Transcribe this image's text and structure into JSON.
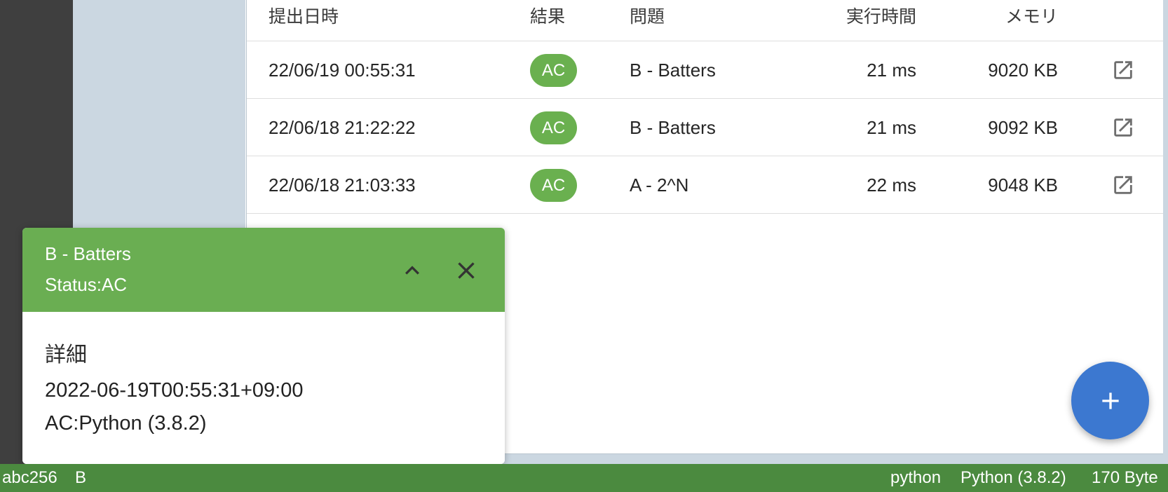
{
  "table": {
    "headers": {
      "date": "提出日時",
      "result": "結果",
      "problem": "問題",
      "time": "実行時間",
      "memory": "メモリ"
    },
    "rows": [
      {
        "date": "22/06/19 00:55:31",
        "result": "AC",
        "problem": "B - Batters",
        "time": "21 ms",
        "memory": "9020 KB"
      },
      {
        "date": "22/06/18 21:22:22",
        "result": "AC",
        "problem": "B - Batters",
        "time": "21 ms",
        "memory": "9092 KB"
      },
      {
        "date": "22/06/18 21:03:33",
        "result": "AC",
        "problem": "A - 2^N",
        "time": "22 ms",
        "memory": "9048 KB"
      }
    ]
  },
  "notification": {
    "title": "B - Batters",
    "status": "Status:AC",
    "detail_title": "詳細",
    "detail_time": "2022-06-19T00:55:31+09:00",
    "detail_lang": "AC:Python (3.8.2)"
  },
  "status_bar": {
    "contest": "abc256",
    "problem": "B",
    "language_id": "python",
    "language_name": "Python (3.8.2)",
    "size": "170 Byte"
  },
  "icons": {
    "open": "open-in-new-icon",
    "collapse": "chevron-up-icon",
    "close": "close-icon",
    "fab": "plus-icon"
  },
  "colors": {
    "accepted_badge": "#6ab04f",
    "notification_header": "#6aae52",
    "fab": "#3c78d0",
    "status_bar": "#4b8a3f"
  }
}
